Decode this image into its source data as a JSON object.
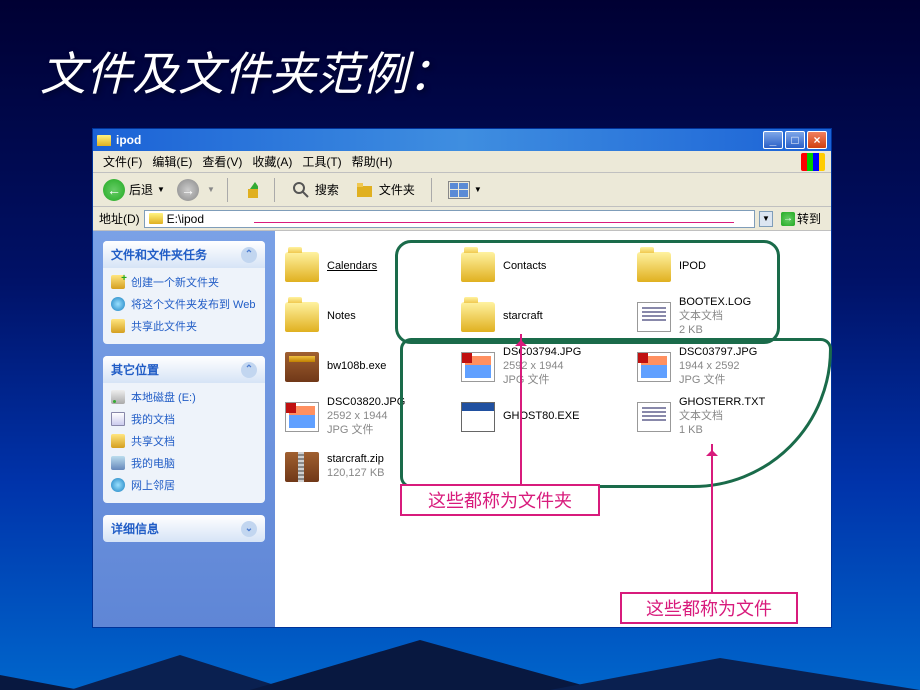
{
  "slide_title": "文件及文件夹范例：",
  "window": {
    "title": "ipod"
  },
  "menu": {
    "file": "文件(F)",
    "edit": "编辑(E)",
    "view": "查看(V)",
    "fav": "收藏(A)",
    "tools": "工具(T)",
    "help": "帮助(H)"
  },
  "toolbar": {
    "back": "后退",
    "search": "搜索",
    "folders": "文件夹"
  },
  "addr": {
    "label": "地址(D)",
    "path": "E:\\ipod",
    "go": "转到"
  },
  "sidebar": {
    "tasks": {
      "title": "文件和文件夹任务",
      "new_folder": "创建一个新文件夹",
      "publish": "将这个文件夹发布到 Web",
      "share": "共享此文件夹"
    },
    "other": {
      "title": "其它位置",
      "drive": "本地磁盘 (E:)",
      "mydocs": "我的文档",
      "shareddocs": "共享文档",
      "mycomputer": "我的电脑",
      "network": "网上邻居"
    },
    "details": {
      "title": "详细信息"
    }
  },
  "files": {
    "Calendars": {
      "name": "Calendars"
    },
    "Contacts": {
      "name": "Contacts"
    },
    "IPOD": {
      "name": "IPOD"
    },
    "Notes": {
      "name": "Notes"
    },
    "starcraft": {
      "name": "starcraft"
    },
    "bootex": {
      "name": "BOOTEX.LOG",
      "meta1": "文本文档",
      "meta2": "2 KB"
    },
    "bw108b": {
      "name": "bw108b.exe"
    },
    "p3794": {
      "name": "DSC03794.JPG",
      "meta1": "2592 x 1944",
      "meta2": "JPG 文件"
    },
    "p3797": {
      "name": "DSC03797.JPG",
      "meta1": "1944 x 2592",
      "meta2": "JPG 文件"
    },
    "p3820": {
      "name": "DSC03820.JPG",
      "meta1": "2592 x 1944",
      "meta2": "JPG 文件"
    },
    "ghost80": {
      "name": "GHOST80.EXE"
    },
    "ghosterr": {
      "name": "GHOSTERR.TXT",
      "meta1": "文本文档",
      "meta2": "1 KB"
    },
    "starcraftzip": {
      "name": "starcraft.zip",
      "meta1": "120,127 KB"
    }
  },
  "callouts": {
    "folders": "这些都称为文件夹",
    "files": "这些都称为文件"
  }
}
